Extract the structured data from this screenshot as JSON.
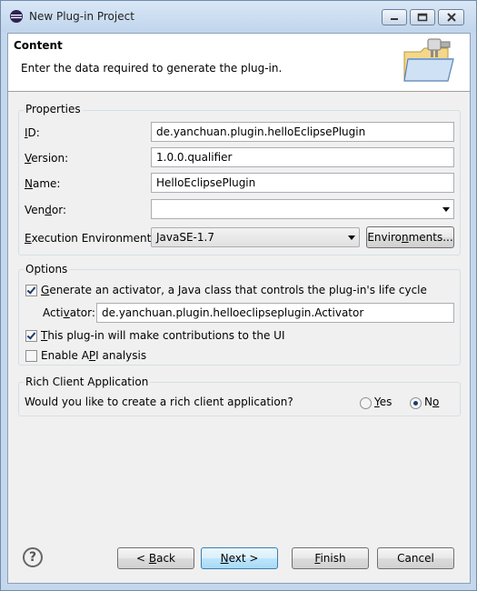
{
  "window": {
    "title": "New Plug-in Project"
  },
  "banner": {
    "title": "Content",
    "description": "Enter the data required to generate the plug-in."
  },
  "properties": {
    "group_label": "Properties",
    "id_label": "ID:",
    "id_value": "de.yanchuan.plugin.helloEclipsePlugin",
    "version_label": "Version:",
    "version_value": "1.0.0.qualifier",
    "name_label": "Name:",
    "name_value": "HelloEclipsePlugin",
    "vendor_label": "Vendor:",
    "vendor_value": "",
    "exec_env_label": "Execution Environment:",
    "exec_env_value": "JavaSE-1.7",
    "environments_button": "Environments..."
  },
  "options": {
    "group_label": "Options",
    "generate_activator_label": "Generate an activator, a Java class that controls the plug-in's life cycle",
    "generate_activator_checked": true,
    "activator_label": "Activator:",
    "activator_value": "de.yanchuan.plugin.helloeclipseplugin.Activator",
    "ui_contrib_label": "This plug-in will make contributions to the UI",
    "ui_contrib_checked": true,
    "api_analysis_label": "Enable API analysis",
    "api_analysis_checked": false
  },
  "rca": {
    "group_label": "Rich Client Application",
    "question": "Would you like to create a rich client application?",
    "yes_label": "Yes",
    "no_label": "No",
    "selected": "No"
  },
  "footer": {
    "help_icon": "question-mark",
    "back_label": "< Back",
    "next_label": "Next >",
    "finish_label": "Finish",
    "cancel_label": "Cancel"
  }
}
